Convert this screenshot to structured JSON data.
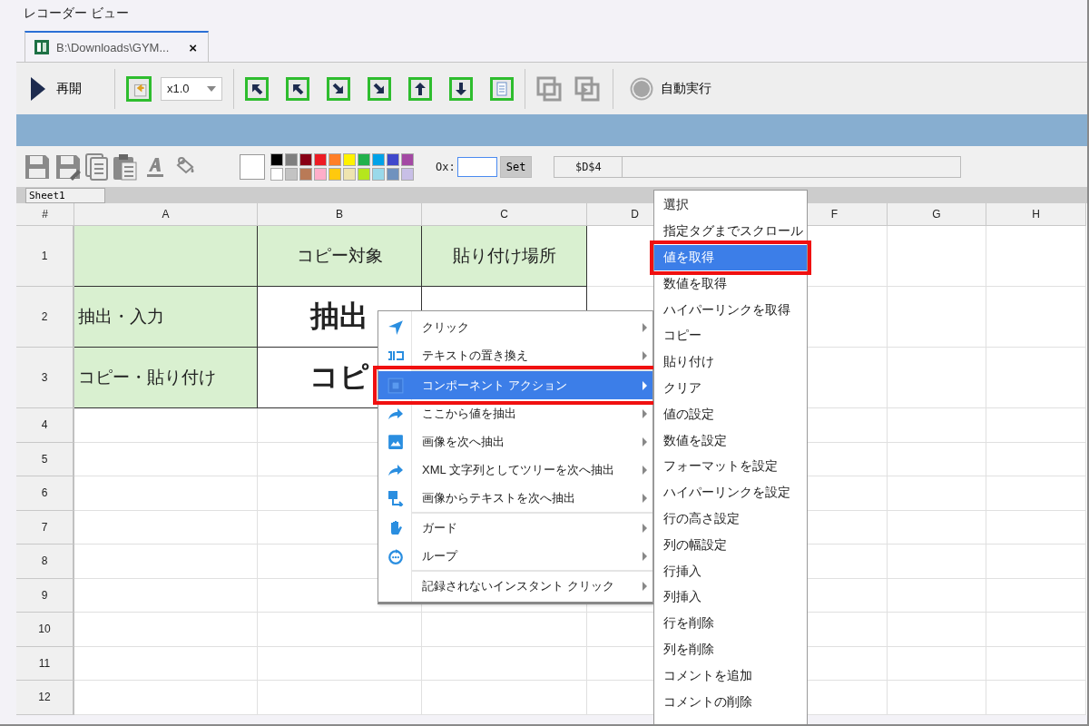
{
  "window": {
    "title": "レコーダー ビュー"
  },
  "tabs": [
    {
      "label": "B:\\Downloads\\GYM...",
      "close": "×",
      "selected": true
    }
  ],
  "toolbar": {
    "resume": "再開",
    "speed": "x1.0",
    "auto_run": "自動実行",
    "auto_run_disabled": true
  },
  "sheet_toolbar": {
    "palette": [
      {
        "color": "#000000"
      },
      {
        "color": "#7f7f7f"
      },
      {
        "color": "#880015"
      },
      {
        "color": "#ed1c24"
      },
      {
        "color": "#ff7f27"
      },
      {
        "color": "#fff200"
      },
      {
        "color": "#22b14c"
      },
      {
        "color": "#00a2e8"
      },
      {
        "color": "#3f48cc"
      },
      {
        "color": "#a349a4"
      },
      {
        "color": "#ffffff"
      },
      {
        "color": "#c3c3c3"
      },
      {
        "color": "#b97a57"
      },
      {
        "color": "#ffaec9"
      },
      {
        "color": "#ffc90e"
      },
      {
        "color": "#efe4b0"
      },
      {
        "color": "#b5e61d"
      },
      {
        "color": "#99d9ea"
      },
      {
        "color": "#7092be"
      },
      {
        "color": "#c8bfe7"
      }
    ],
    "ox_label": "Ox:",
    "set_button": "Set",
    "cell_ref": "$D$4"
  },
  "sheet_tabs": [
    {
      "label": "Sheet1",
      "selected": true
    }
  ],
  "grid": {
    "columns": [
      {
        "label": "#"
      },
      {
        "label": "A"
      },
      {
        "label": "B"
      },
      {
        "label": "C"
      },
      {
        "label": "D"
      },
      {},
      {
        "label": "F"
      },
      {
        "label": "G"
      },
      {
        "label": "H"
      }
    ],
    "rows": [
      {
        "number": "1",
        "cells": [
          {
            "shaded": true
          },
          {
            "text": "コピー対象",
            "shaded": true
          },
          {
            "text": "貼り付け場所",
            "shaded": true
          }
        ]
      },
      {
        "number": "2",
        "cells": [
          {
            "text": "抽出・入力",
            "shaded": true
          },
          {
            "text": "抽出",
            "kind": "large",
            "shaded": false
          },
          {}
        ]
      },
      {
        "number": "3",
        "cells": [
          {
            "text": "コピー・貼り付け",
            "shaded": true
          },
          {
            "text": "コピ",
            "kind": "large",
            "shaded": false
          },
          {}
        ]
      },
      {
        "number": "4"
      },
      {
        "number": "5"
      },
      {
        "number": "6"
      },
      {
        "number": "7"
      },
      {
        "number": "8"
      },
      {
        "number": "9"
      },
      {
        "number": "10"
      },
      {
        "number": "11"
      },
      {
        "number": "12"
      }
    ]
  },
  "context_menu": {
    "groups": [
      [
        {
          "label": "クリック",
          "kind": "send",
          "selected": false,
          "outlined": false
        },
        {
          "label": "テキストの置き換え",
          "kind": "replace",
          "selected": false,
          "outlined": false
        }
      ],
      [
        {
          "label": "コンポーネント アクション",
          "kind": "component",
          "selected": true,
          "outlined": true
        },
        {
          "label": "ここから値を抽出",
          "kind": "share",
          "selected": false,
          "outlined": false
        },
        {
          "label": "画像を次へ抽出",
          "kind": "image",
          "selected": false,
          "outlined": false
        },
        {
          "label": "XML 文字列としてツリーを次へ抽出",
          "kind": "share",
          "selected": false,
          "outlined": false
        },
        {
          "label": "画像からテキストを次へ抽出",
          "kind": "ocr",
          "selected": false,
          "outlined": false
        }
      ],
      [
        {
          "label": "ガード",
          "kind": "hand",
          "selected": false,
          "outlined": false
        },
        {
          "label": "ループ",
          "kind": "loop",
          "selected": false,
          "outlined": false
        }
      ],
      [
        {
          "label": "記録されないインスタント クリック",
          "kind": "plain",
          "selected": false,
          "outlined": false
        }
      ]
    ]
  },
  "submenu": {
    "items": [
      {
        "label": "選択",
        "selected": false,
        "outlined": false
      },
      {
        "label": "指定タグまでスクロール",
        "selected": false,
        "outlined": false
      },
      {
        "label": "値を取得",
        "selected": true,
        "outlined": true
      },
      {
        "label": "数値を取得",
        "selected": false,
        "outlined": false
      },
      {
        "label": "ハイパーリンクを取得",
        "selected": false,
        "outlined": false
      },
      {
        "label": "コピー",
        "selected": false,
        "outlined": false
      },
      {
        "label": "貼り付け",
        "selected": false,
        "outlined": false
      },
      {
        "label": "クリア",
        "selected": false,
        "outlined": false
      },
      {
        "label": "値の設定",
        "selected": false,
        "outlined": false
      },
      {
        "label": "数値を設定",
        "selected": false,
        "outlined": false
      },
      {
        "label": "フォーマットを設定",
        "selected": false,
        "outlined": false
      },
      {
        "label": "ハイパーリンクを設定",
        "selected": false,
        "outlined": false
      },
      {
        "label": "行の高さ設定",
        "selected": false,
        "outlined": false
      },
      {
        "label": "列の幅設定",
        "selected": false,
        "outlined": false
      },
      {
        "label": "行挿入",
        "selected": false,
        "outlined": false
      },
      {
        "label": "列挿入",
        "selected": false,
        "outlined": false
      },
      {
        "label": "行を削除",
        "selected": false,
        "outlined": false
      },
      {
        "label": "列を削除",
        "selected": false,
        "outlined": false
      },
      {
        "label": "コメントを追加",
        "selected": false,
        "outlined": false
      },
      {
        "label": "コメントの削除",
        "selected": false,
        "outlined": false
      }
    ]
  }
}
